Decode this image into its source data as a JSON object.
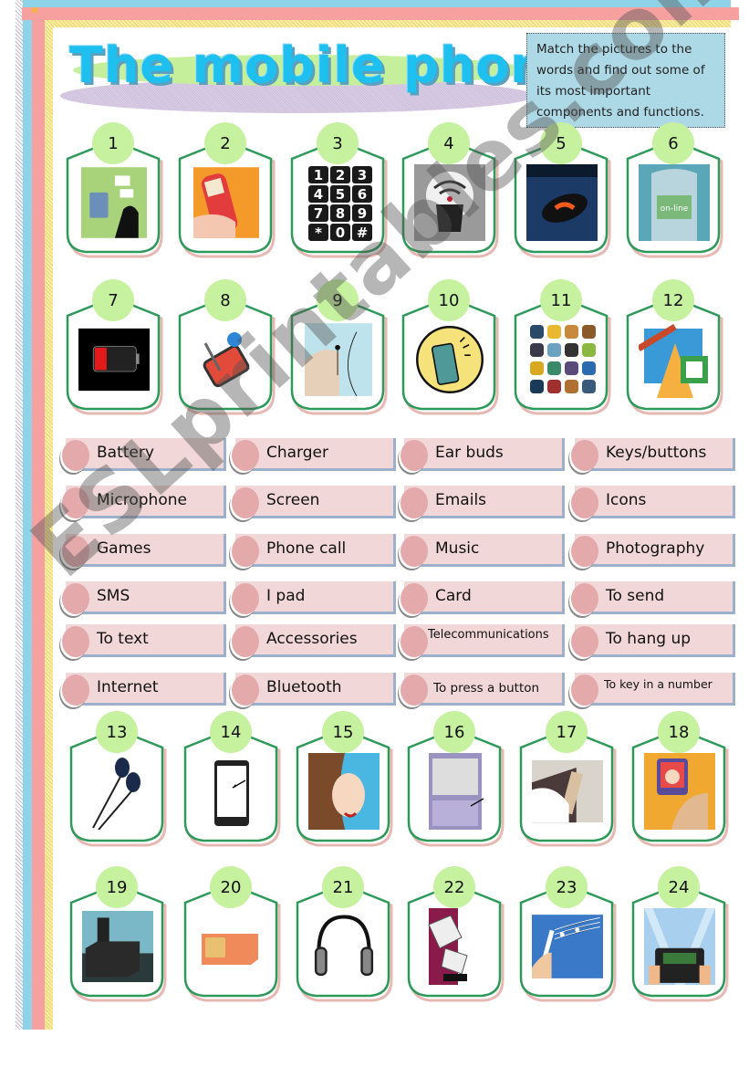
{
  "title": "The mobile phone",
  "instructions": "Match the pictures to the words and find out some of its most important components and functions.",
  "watermark": "ESLprintables.com",
  "colors": {
    "badge": "#c6f19f",
    "frame": "#2e9a5a",
    "word_bar": "#f2d7d8",
    "word_dot": "#e3a9ab",
    "title": "#1ec0f0",
    "instructions_bg": "#add8e6"
  },
  "pictures": [
    {
      "number": "1",
      "icon": "email-sending-phone-icon"
    },
    {
      "number": "2",
      "icon": "text-message-phone-icon"
    },
    {
      "number": "3",
      "icon": "keypad-icon"
    },
    {
      "number": "4",
      "icon": "wireless-signal-icon"
    },
    {
      "number": "5",
      "icon": "hang-up-button-icon"
    },
    {
      "number": "6",
      "icon": "online-phone-icon"
    },
    {
      "number": "7",
      "icon": "low-battery-icon"
    },
    {
      "number": "8",
      "icon": "stylus-touchscreen-icon"
    },
    {
      "number": "9",
      "icon": "microphone-earpiece-icon"
    },
    {
      "number": "10",
      "icon": "ringing-phone-icon"
    },
    {
      "number": "11",
      "icon": "app-icons-grid-icon"
    },
    {
      "number": "12",
      "icon": "satellite-telecom-icon"
    },
    {
      "number": "13",
      "icon": "earbuds-icon"
    },
    {
      "number": "14",
      "icon": "smartphone-screen-icon"
    },
    {
      "number": "15",
      "icon": "woman-phone-call-icon"
    },
    {
      "number": "16",
      "icon": "press-button-phone-icon"
    },
    {
      "number": "17",
      "icon": "dialing-phone-icon"
    },
    {
      "number": "18",
      "icon": "camera-phone-photo-icon"
    },
    {
      "number": "19",
      "icon": "charger-icon"
    },
    {
      "number": "20",
      "icon": "sim-card-icon"
    },
    {
      "number": "21",
      "icon": "headphones-icon"
    },
    {
      "number": "22",
      "icon": "flip-phone-sms-icon"
    },
    {
      "number": "23",
      "icon": "music-notes-phone-icon"
    },
    {
      "number": "24",
      "icon": "tablet-games-icon"
    }
  ],
  "words": [
    [
      "Battery",
      "Charger",
      "Ear buds",
      "Keys/buttons"
    ],
    [
      "Microphone",
      "Screen",
      "Emails",
      "Icons"
    ],
    [
      "Games",
      "Phone call",
      "Music",
      "Photography"
    ],
    [
      "SMS",
      "I pad",
      "Card",
      "To send"
    ],
    [
      "To text",
      "Accessories",
      "Telecommunications",
      "To hang up"
    ],
    [
      "Internet",
      "Bluetooth",
      "To press a button",
      "To key in a number"
    ]
  ]
}
